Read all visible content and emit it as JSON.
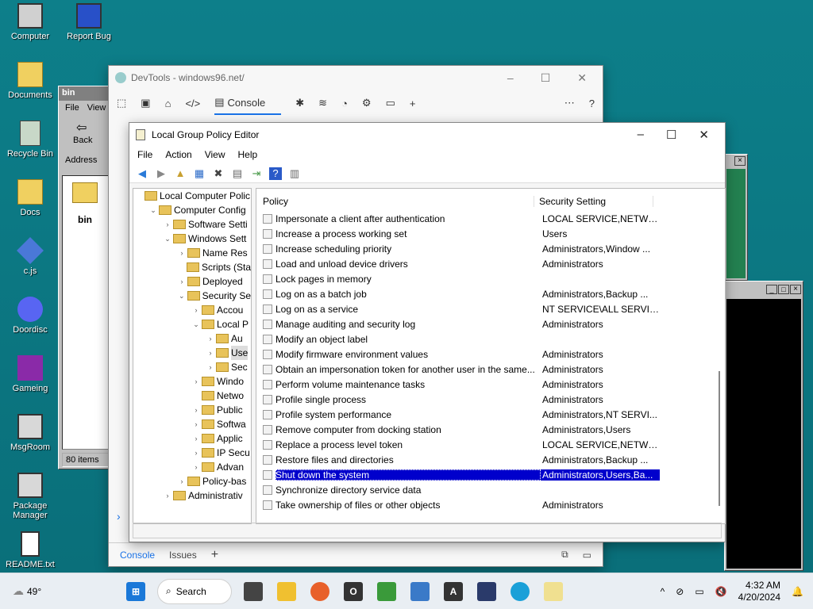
{
  "desktop": {
    "icons": [
      {
        "label": "Computer"
      },
      {
        "label": "Report Bug"
      },
      {
        "label": "Documents"
      },
      {
        "label": "Recycle Bin"
      },
      {
        "label": "Docs"
      },
      {
        "label": "c.js"
      },
      {
        "label": "Doordisc"
      },
      {
        "label": "Gameing"
      },
      {
        "label": "MsgRoom"
      },
      {
        "label": "Package Manager"
      },
      {
        "label": "README.txt"
      }
    ]
  },
  "bin_window": {
    "title": "bin",
    "menu": [
      "File",
      "View"
    ],
    "back_label": "Back",
    "address_label": "Address",
    "folder_label": "bin",
    "status": "80 items"
  },
  "devtools": {
    "title": "DevTools - windows96.net/",
    "console_tab": "Console",
    "bottom_tabs": [
      "Console",
      "Issues"
    ]
  },
  "gpedit": {
    "title": "Local Group Policy Editor",
    "menu": [
      "File",
      "Action",
      "View",
      "Help"
    ],
    "tree": [
      {
        "label": "Local Computer Polic",
        "indent": 0,
        "exp": ""
      },
      {
        "label": "Computer Config",
        "indent": 1,
        "exp": "v"
      },
      {
        "label": "Software Setti",
        "indent": 2,
        "exp": ">"
      },
      {
        "label": "Windows Sett",
        "indent": 2,
        "exp": "v"
      },
      {
        "label": "Name Res",
        "indent": 3,
        "exp": ">"
      },
      {
        "label": "Scripts (Sta",
        "indent": 3,
        "exp": ""
      },
      {
        "label": "Deployed",
        "indent": 3,
        "exp": ">"
      },
      {
        "label": "Security Se",
        "indent": 3,
        "exp": "v"
      },
      {
        "label": "Accou",
        "indent": 4,
        "exp": ">"
      },
      {
        "label": "Local P",
        "indent": 4,
        "exp": "v"
      },
      {
        "label": "Au",
        "indent": 5,
        "exp": ">"
      },
      {
        "label": "Use",
        "indent": 5,
        "exp": ">"
      },
      {
        "label": "Sec",
        "indent": 5,
        "exp": ">"
      },
      {
        "label": "Windo",
        "indent": 4,
        "exp": ">"
      },
      {
        "label": "Netwo",
        "indent": 4,
        "exp": ""
      },
      {
        "label": "Public",
        "indent": 4,
        "exp": ">"
      },
      {
        "label": "Softwa",
        "indent": 4,
        "exp": ">"
      },
      {
        "label": "Applic",
        "indent": 4,
        "exp": ">"
      },
      {
        "label": "IP Secu",
        "indent": 4,
        "exp": ">"
      },
      {
        "label": "Advan",
        "indent": 4,
        "exp": ">"
      },
      {
        "label": "Policy-bas",
        "indent": 3,
        "exp": ">"
      },
      {
        "label": "Administrativ",
        "indent": 2,
        "exp": ">"
      }
    ],
    "columns": {
      "policy": "Policy",
      "setting": "Security Setting"
    },
    "rows": [
      {
        "policy": "Impersonate a client after authentication",
        "setting": "LOCAL SERVICE,NETWO..."
      },
      {
        "policy": "Increase a process working set",
        "setting": "Users"
      },
      {
        "policy": "Increase scheduling priority",
        "setting": "Administrators,Window ..."
      },
      {
        "policy": "Load and unload device drivers",
        "setting": "Administrators"
      },
      {
        "policy": "Lock pages in memory",
        "setting": ""
      },
      {
        "policy": "Log on as a batch job",
        "setting": "Administrators,Backup ..."
      },
      {
        "policy": "Log on as a service",
        "setting": "NT SERVICE\\ALL SERVIC..."
      },
      {
        "policy": "Manage auditing and security log",
        "setting": "Administrators"
      },
      {
        "policy": "Modify an object label",
        "setting": ""
      },
      {
        "policy": "Modify firmware environment values",
        "setting": "Administrators"
      },
      {
        "policy": "Obtain an impersonation token for another user in the same...",
        "setting": "Administrators"
      },
      {
        "policy": "Perform volume maintenance tasks",
        "setting": "Administrators"
      },
      {
        "policy": "Profile single process",
        "setting": "Administrators"
      },
      {
        "policy": "Profile system performance",
        "setting": "Administrators,NT SERVI..."
      },
      {
        "policy": "Remove computer from docking station",
        "setting": "Administrators,Users"
      },
      {
        "policy": "Replace a process level token",
        "setting": "LOCAL SERVICE,NETWO..."
      },
      {
        "policy": "Restore files and directories",
        "setting": "Administrators,Backup ..."
      },
      {
        "policy": "Shut down the system",
        "setting": "Administrators,Users,Ba...",
        "selected": true
      },
      {
        "policy": "Synchronize directory service data",
        "setting": ""
      },
      {
        "policy": "Take ownership of files or other objects",
        "setting": "Administrators"
      }
    ]
  },
  "taskbar": {
    "weather": "49°",
    "search_label": "Search",
    "time": "4:32 AM",
    "date": "4/20/2024"
  }
}
